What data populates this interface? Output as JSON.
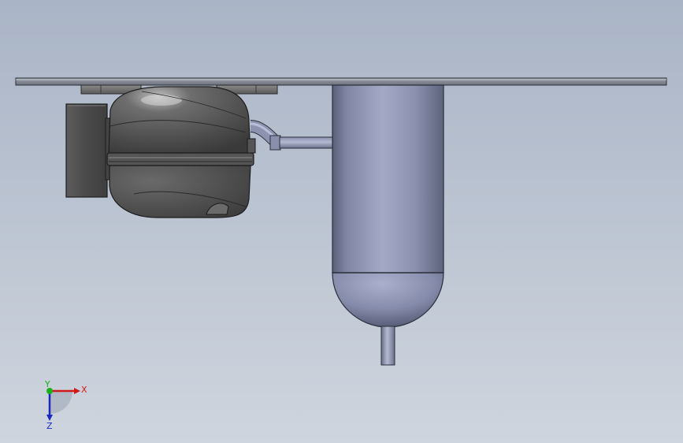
{
  "viewport": {
    "background_top": "#a9b4c6",
    "background_bottom": "#cfd5de"
  },
  "model": {
    "parts": [
      "mounting-plate",
      "compressor",
      "electrical-box",
      "connecting-pipe",
      "vertical-tank",
      "tank-outlet-pipe"
    ]
  },
  "triad": {
    "x_label": "X",
    "y_label": "Y",
    "z_label": "Z",
    "x_color": "#d01818",
    "y_color": "#18b018",
    "z_color": "#1828c0"
  }
}
